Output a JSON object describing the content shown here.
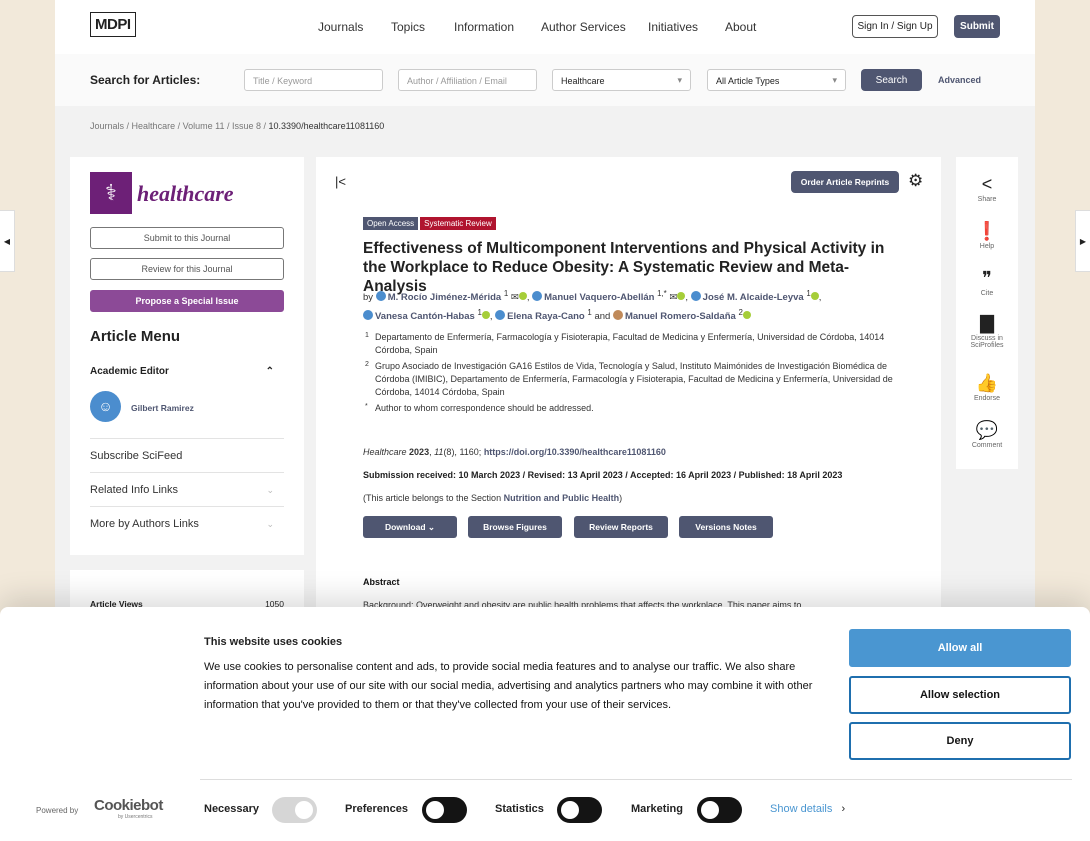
{
  "header": {
    "logo": "MDPI",
    "nav": [
      "Journals",
      "Topics",
      "Information",
      "Author Services",
      "Initiatives",
      "About"
    ],
    "sign_in": "Sign In / Sign Up",
    "submit": "Submit"
  },
  "search": {
    "label": "Search for Articles:",
    "title_placeholder": "Title / Keyword",
    "author_placeholder": "Author / Affiliation / Email",
    "journal": "Healthcare",
    "article_type": "All Article Types",
    "search_button": "Search",
    "advanced": "Advanced"
  },
  "breadcrumb": [
    "Journals",
    "Healthcare",
    "Volume 11",
    "Issue 8",
    "10.3390/healthcare11081160"
  ],
  "sidebar": {
    "journal_name": "healthcare",
    "submit": "Submit to this Journal",
    "review": "Review for this Journal",
    "propose": "Propose a Special Issue",
    "menu_title": "Article Menu",
    "academic_editor": "Academic Editor",
    "editor_name": "Gilbert Ramirez",
    "items": [
      "Subscribe SciFeed",
      "Related Info Links",
      "More by Authors Links"
    ],
    "views_label": "Article Views",
    "views_value": "1050"
  },
  "article": {
    "order_reprints": "Order Article Reprints",
    "tags": [
      "Open Access",
      "Systematic Review"
    ],
    "title": "Effectiveness of Multicomponent Interventions and Physical Activity in the Workplace to Reduce Obesity: A Systematic Review and Meta-Analysis",
    "by": "by",
    "authors": [
      {
        "name": "M. Rocío Jiménez-Mérida",
        "sup": "1"
      },
      {
        "name": "Manuel Vaquero-Abellán",
        "sup": "1,*"
      },
      {
        "name": "José M. Alcaide-Leyva",
        "sup": "1"
      },
      {
        "name": "Vanesa Cantón-Habas",
        "sup": "1"
      },
      {
        "name": "Elena Raya-Cano",
        "sup": "1"
      },
      {
        "name": "Manuel Romero-Saldaña",
        "sup": "2"
      }
    ],
    "and": "and",
    "affiliations": [
      {
        "mark": "1",
        "text": "Departamento de Enfermería, Farmacología y Fisioterapia, Facultad de Medicina y Enfermería, Universidad de Córdoba, 14014 Córdoba, Spain"
      },
      {
        "mark": "2",
        "text": "Grupo Asociado de Investigación GA16 Estilos de Vida, Tecnología y Salud, Instituto Maimónides de Investigación Biomédica de Córdoba (IMIBIC), Departamento de Enfermería, Farmacología y Fisioterapia, Facultad de Medicina y Enfermería, Universidad de Córdoba, 14014 Córdoba, Spain"
      },
      {
        "mark": "*",
        "text": "Author to whom correspondence should be addressed."
      }
    ],
    "journal": "Healthcare",
    "year": "2023",
    "volume": "11",
    "issue_pages": "(8), 1160;",
    "doi": "https://doi.org/10.3390/healthcare11081160",
    "dates": "Submission received: 10 March 2023 / Revised: 13 April 2023 / Accepted: 16 April 2023 / Published: 18 April 2023",
    "section_prefix": "(This article belongs to the Section ",
    "section": "Nutrition and Public Health",
    "section_suffix": ")",
    "buttons": [
      "Download",
      "Browse Figures",
      "Review Reports",
      "Versions Notes"
    ],
    "abstract_title": "Abstract",
    "abstract_text": "Background: Overweight and obesity are public health problems that affects the workplace. This paper aims to"
  },
  "right_bar": [
    "Share",
    "Help",
    "Cite",
    "Discuss in SciProfiles",
    "Endorse",
    "Comment"
  ],
  "cookie": {
    "title": "This website uses cookies",
    "text": "We use cookies to personalise content and ads, to provide social media features and to analyse our traffic. We also share information about your use of our site with our social media, advertising and analytics partners who may combine it with other information that you've provided to them or that they've collected from your use of their services.",
    "allow_all": "Allow all",
    "allow_selection": "Allow selection",
    "deny": "Deny",
    "powered_by": "Powered by",
    "brand": "Cookiebot",
    "brand_sub": "by Usercentrics",
    "toggles": [
      {
        "label": "Necessary",
        "on": true,
        "disabled": true
      },
      {
        "label": "Preferences",
        "on": false
      },
      {
        "label": "Statistics",
        "on": false
      },
      {
        "label": "Marketing",
        "on": false
      }
    ],
    "show_details": "Show details"
  },
  "colors": {
    "accent": "#4f5671",
    "journal": "#6d2077",
    "allow_all": "#4a96d1",
    "systematic_review": "#b0142f"
  }
}
